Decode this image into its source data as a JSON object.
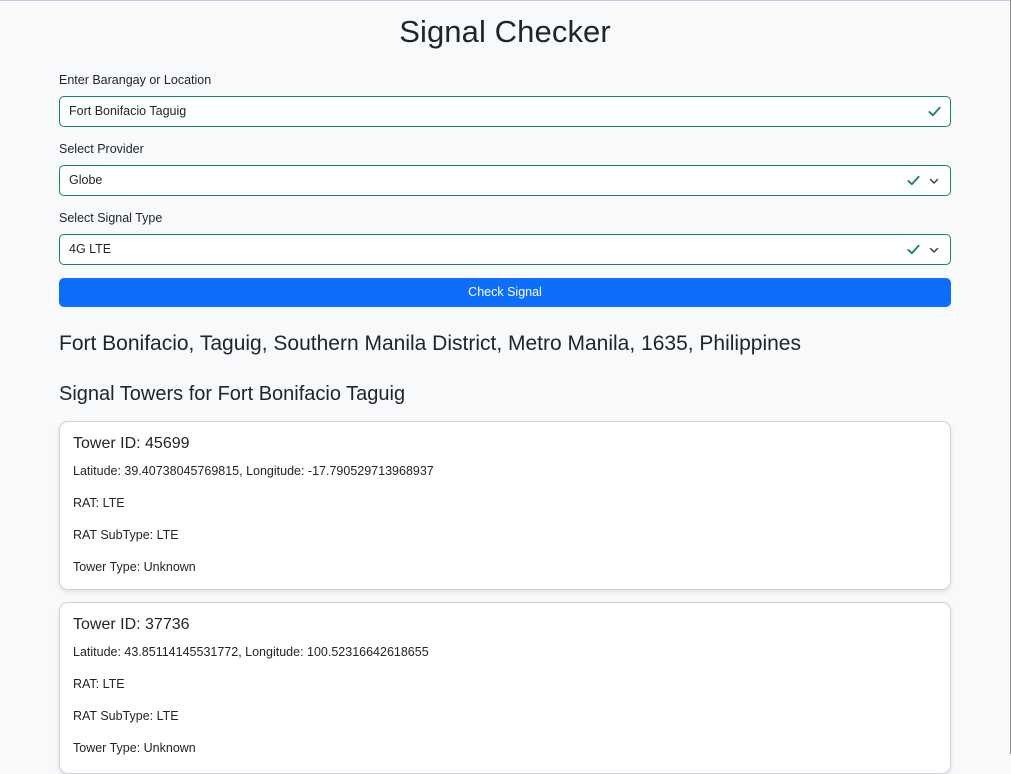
{
  "title": "Signal Checker",
  "form": {
    "location": {
      "label": "Enter Barangay or Location",
      "value": "Fort Bonifacio Taguig"
    },
    "provider": {
      "label": "Select Provider",
      "value": "Globe"
    },
    "signal_type": {
      "label": "Select Signal Type",
      "value": "4G LTE"
    },
    "submit_label": "Check Signal"
  },
  "result": {
    "address": "Fort Bonifacio, Taguig, Southern Manila District, Metro Manila, 1635, Philippines",
    "towers_heading": "Signal Towers for Fort Bonifacio Taguig",
    "towers": [
      {
        "id_text": "Tower ID: 45699",
        "coords_text": "Latitude: 39.40738045769815, Longitude: -17.790529713968937",
        "rat_text": "RAT: LTE",
        "rat_subtype_text": "RAT SubType: LTE",
        "tower_type_text": "Tower Type: Unknown"
      },
      {
        "id_text": "Tower ID: 37736",
        "coords_text": "Latitude: 43.85114145531772, Longitude: 100.52316642618655",
        "rat_text": "RAT: LTE",
        "rat_subtype_text": "RAT SubType: LTE",
        "tower_type_text": "Tower Type: Unknown"
      }
    ]
  },
  "icons": {
    "valid": "check-icon",
    "dropdown": "chevron-down-icon"
  },
  "colors": {
    "primary": "#0d6efd",
    "valid": "#198754",
    "text": "#212529",
    "background": "#f8f9fb"
  }
}
